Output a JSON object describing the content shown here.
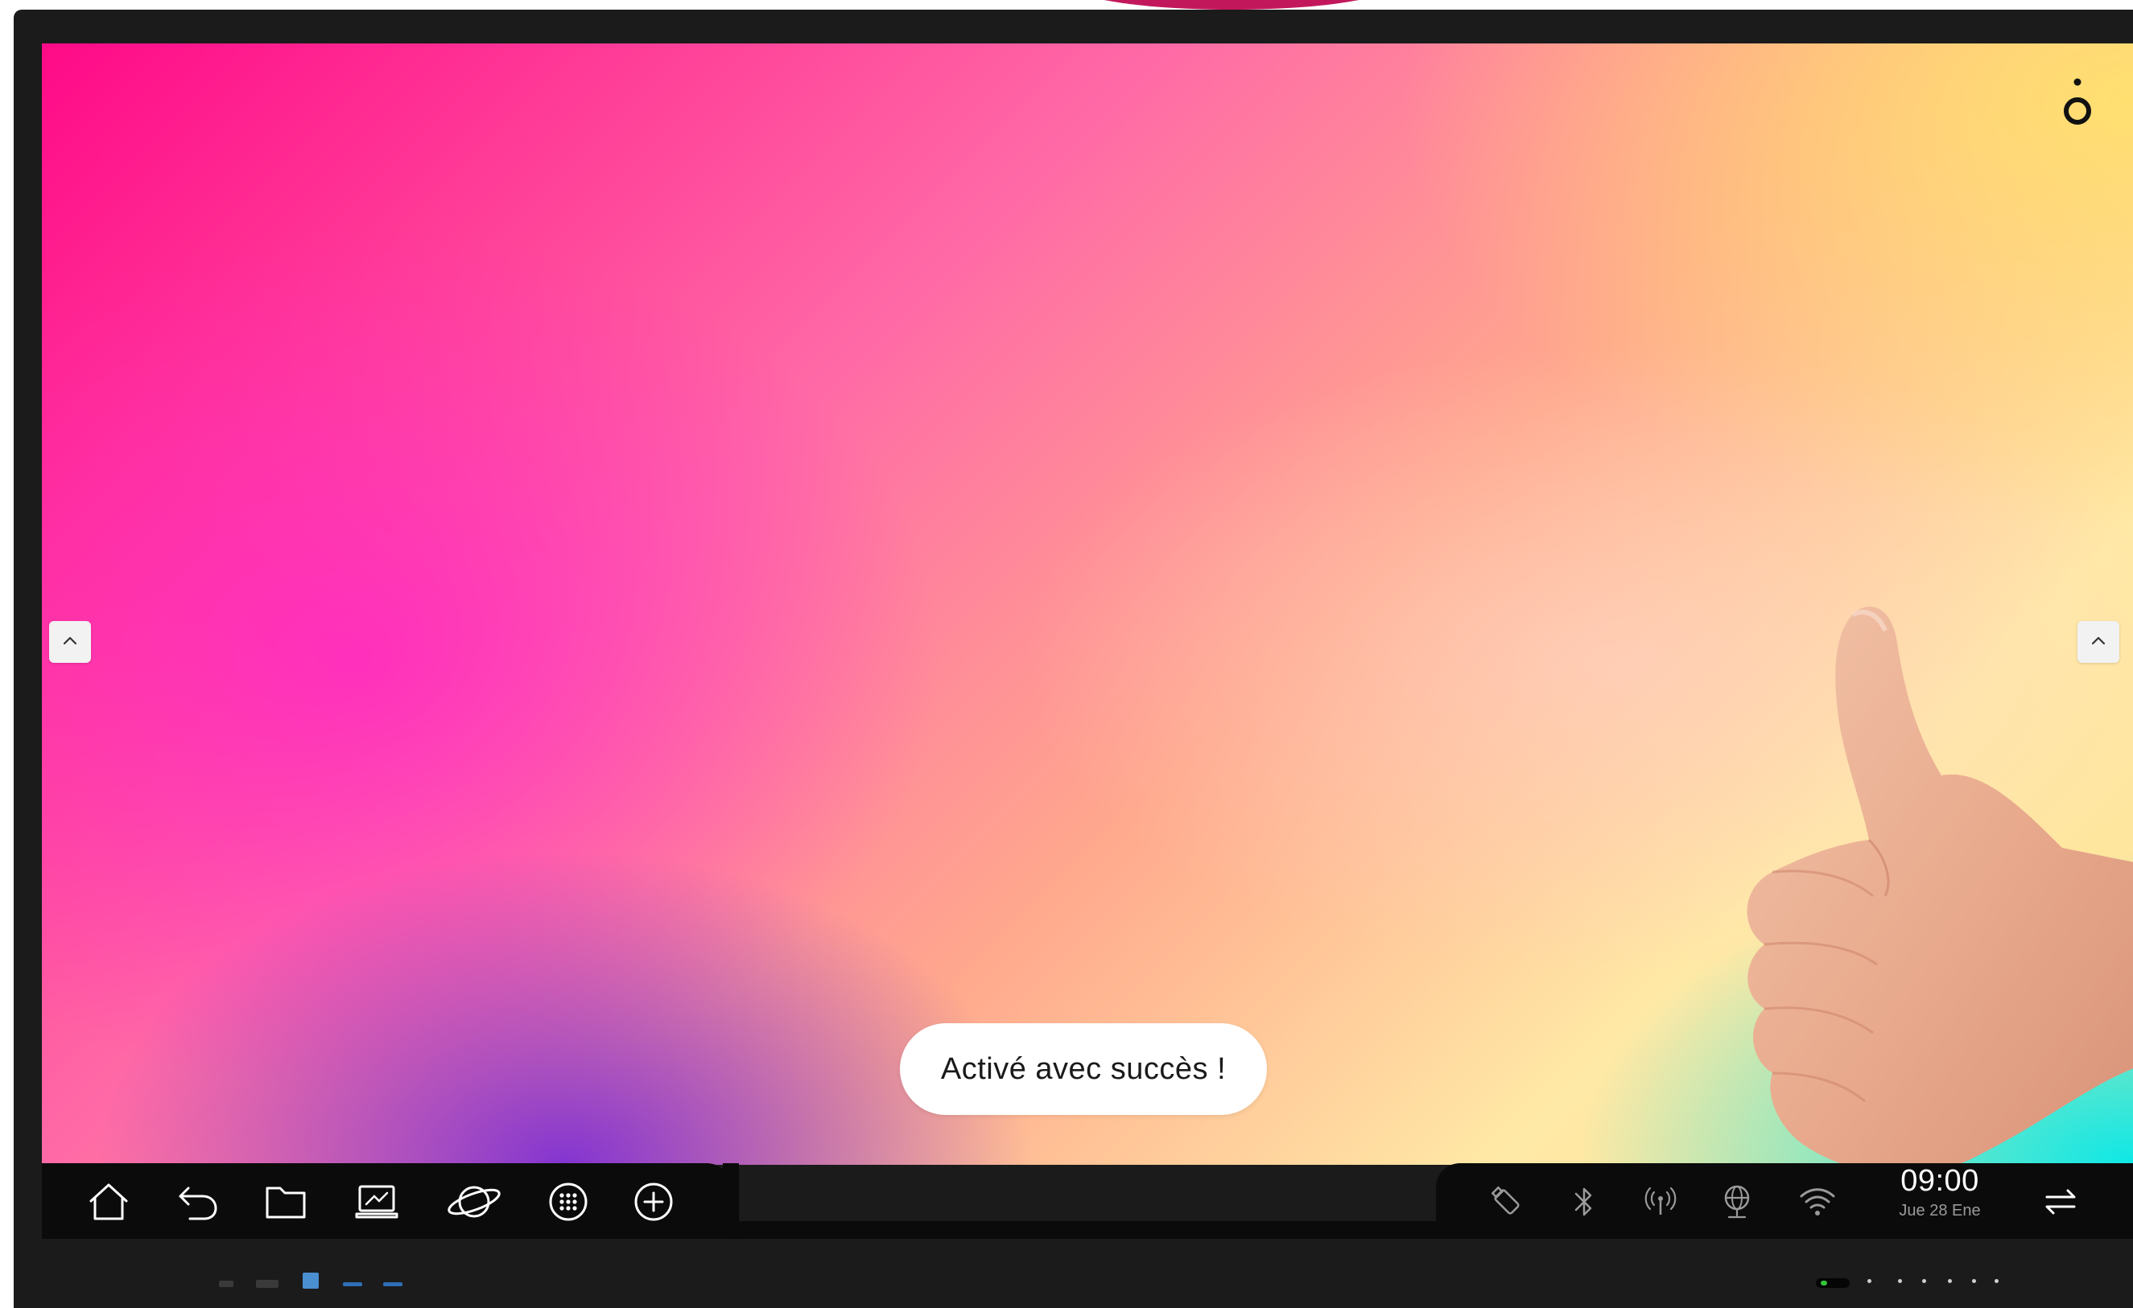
{
  "screen": {
    "toast_message": "Activé avec succès !",
    "brand_icon": "brand-mark-icon"
  },
  "nav": {
    "left_arrow_icon": "chevron-up-icon",
    "right_arrow_icon": "chevron-up-icon"
  },
  "taskbar": {
    "left_icons": [
      "home-icon",
      "back-icon",
      "folder-icon",
      "whiteboard-icon",
      "browser-icon",
      "apps-icon",
      "add-icon"
    ],
    "right_icons": [
      "usb-drive-icon",
      "bluetooth-icon",
      "hotspot-icon",
      "network-icon",
      "wifi-icon"
    ],
    "clock": {
      "time": "09:00",
      "date": "Jue 28 Ene"
    },
    "switch_icon": "input-switch-icon"
  },
  "colors": {
    "bezel": "#1b1b1b",
    "taskbar": "#0b0b0b",
    "toast_bg": "#ffffff",
    "gradient_pink": "#ff0a88",
    "gradient_yellow": "#ffe296",
    "gradient_cyan": "#00e8eb",
    "gradient_purple": "#762ad7"
  }
}
